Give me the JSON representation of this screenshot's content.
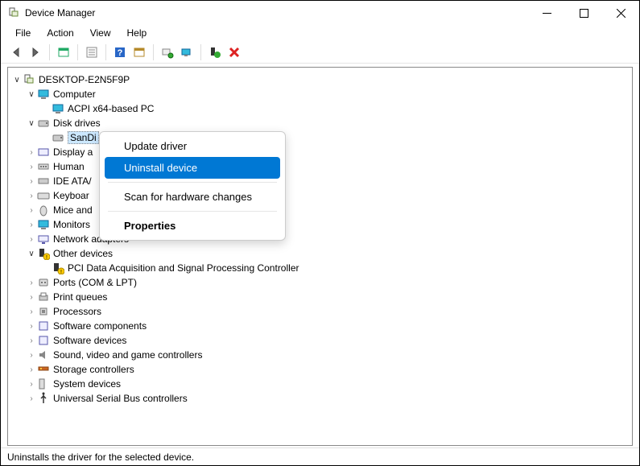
{
  "window": {
    "title": "Device Manager",
    "computer_name": "DESKTOP-E2N5F9P"
  },
  "menu": {
    "file": "File",
    "action": "Action",
    "view": "View",
    "help": "Help"
  },
  "toolbar": {
    "back": "back",
    "forward": "forward"
  },
  "tree": {
    "computer": {
      "label": "Computer",
      "child": "ACPI x64-based PC"
    },
    "disk": {
      "label": "Disk drives",
      "child": "SanDi"
    },
    "display": "Display a",
    "hid": "Human",
    "ide": "IDE ATA/",
    "keyboard": "Keyboar",
    "mice": "Mice and",
    "monitors": "Monitors",
    "network": "Network adapters",
    "other": {
      "label": "Other devices",
      "child": "PCI Data Acquisition and Signal Processing Controller"
    },
    "ports": "Ports (COM & LPT)",
    "printq": "Print queues",
    "processors": "Processors",
    "swcomp": "Software components",
    "swdev": "Software devices",
    "sound": "Sound, video and game controllers",
    "storage": "Storage controllers",
    "system": "System devices",
    "usb": "Universal Serial Bus controllers"
  },
  "context": {
    "update": "Update driver",
    "uninstall": "Uninstall device",
    "scan": "Scan for hardware changes",
    "properties": "Properties"
  },
  "status": "Uninstalls the driver for the selected device."
}
